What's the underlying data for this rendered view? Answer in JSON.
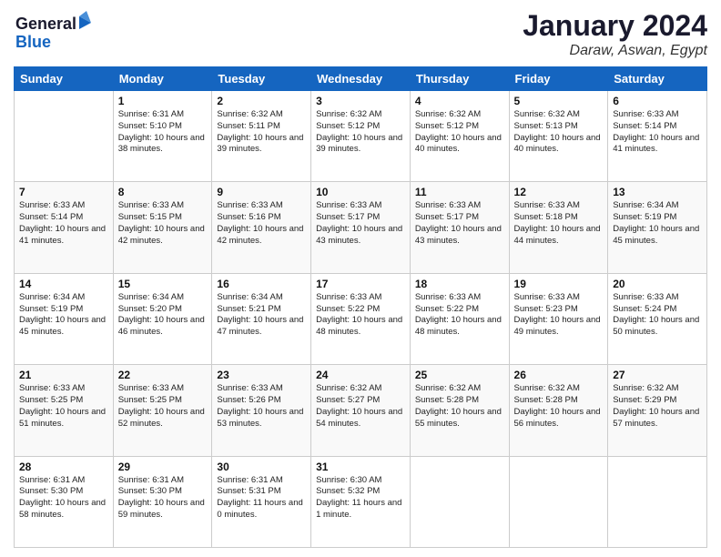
{
  "logo": {
    "line1": "General",
    "line2": "Blue"
  },
  "title": "January 2024",
  "location": "Daraw, Aswan, Egypt",
  "headers": [
    "Sunday",
    "Monday",
    "Tuesday",
    "Wednesday",
    "Thursday",
    "Friday",
    "Saturday"
  ],
  "weeks": [
    [
      {
        "day": "",
        "sunrise": "",
        "sunset": "",
        "daylight": ""
      },
      {
        "day": "1",
        "sunrise": "Sunrise: 6:31 AM",
        "sunset": "Sunset: 5:10 PM",
        "daylight": "Daylight: 10 hours and 38 minutes."
      },
      {
        "day": "2",
        "sunrise": "Sunrise: 6:32 AM",
        "sunset": "Sunset: 5:11 PM",
        "daylight": "Daylight: 10 hours and 39 minutes."
      },
      {
        "day": "3",
        "sunrise": "Sunrise: 6:32 AM",
        "sunset": "Sunset: 5:12 PM",
        "daylight": "Daylight: 10 hours and 39 minutes."
      },
      {
        "day": "4",
        "sunrise": "Sunrise: 6:32 AM",
        "sunset": "Sunset: 5:12 PM",
        "daylight": "Daylight: 10 hours and 40 minutes."
      },
      {
        "day": "5",
        "sunrise": "Sunrise: 6:32 AM",
        "sunset": "Sunset: 5:13 PM",
        "daylight": "Daylight: 10 hours and 40 minutes."
      },
      {
        "day": "6",
        "sunrise": "Sunrise: 6:33 AM",
        "sunset": "Sunset: 5:14 PM",
        "daylight": "Daylight: 10 hours and 41 minutes."
      }
    ],
    [
      {
        "day": "7",
        "sunrise": "Sunrise: 6:33 AM",
        "sunset": "Sunset: 5:14 PM",
        "daylight": "Daylight: 10 hours and 41 minutes."
      },
      {
        "day": "8",
        "sunrise": "Sunrise: 6:33 AM",
        "sunset": "Sunset: 5:15 PM",
        "daylight": "Daylight: 10 hours and 42 minutes."
      },
      {
        "day": "9",
        "sunrise": "Sunrise: 6:33 AM",
        "sunset": "Sunset: 5:16 PM",
        "daylight": "Daylight: 10 hours and 42 minutes."
      },
      {
        "day": "10",
        "sunrise": "Sunrise: 6:33 AM",
        "sunset": "Sunset: 5:17 PM",
        "daylight": "Daylight: 10 hours and 43 minutes."
      },
      {
        "day": "11",
        "sunrise": "Sunrise: 6:33 AM",
        "sunset": "Sunset: 5:17 PM",
        "daylight": "Daylight: 10 hours and 43 minutes."
      },
      {
        "day": "12",
        "sunrise": "Sunrise: 6:33 AM",
        "sunset": "Sunset: 5:18 PM",
        "daylight": "Daylight: 10 hours and 44 minutes."
      },
      {
        "day": "13",
        "sunrise": "Sunrise: 6:34 AM",
        "sunset": "Sunset: 5:19 PM",
        "daylight": "Daylight: 10 hours and 45 minutes."
      }
    ],
    [
      {
        "day": "14",
        "sunrise": "Sunrise: 6:34 AM",
        "sunset": "Sunset: 5:19 PM",
        "daylight": "Daylight: 10 hours and 45 minutes."
      },
      {
        "day": "15",
        "sunrise": "Sunrise: 6:34 AM",
        "sunset": "Sunset: 5:20 PM",
        "daylight": "Daylight: 10 hours and 46 minutes."
      },
      {
        "day": "16",
        "sunrise": "Sunrise: 6:34 AM",
        "sunset": "Sunset: 5:21 PM",
        "daylight": "Daylight: 10 hours and 47 minutes."
      },
      {
        "day": "17",
        "sunrise": "Sunrise: 6:33 AM",
        "sunset": "Sunset: 5:22 PM",
        "daylight": "Daylight: 10 hours and 48 minutes."
      },
      {
        "day": "18",
        "sunrise": "Sunrise: 6:33 AM",
        "sunset": "Sunset: 5:22 PM",
        "daylight": "Daylight: 10 hours and 48 minutes."
      },
      {
        "day": "19",
        "sunrise": "Sunrise: 6:33 AM",
        "sunset": "Sunset: 5:23 PM",
        "daylight": "Daylight: 10 hours and 49 minutes."
      },
      {
        "day": "20",
        "sunrise": "Sunrise: 6:33 AM",
        "sunset": "Sunset: 5:24 PM",
        "daylight": "Daylight: 10 hours and 50 minutes."
      }
    ],
    [
      {
        "day": "21",
        "sunrise": "Sunrise: 6:33 AM",
        "sunset": "Sunset: 5:25 PM",
        "daylight": "Daylight: 10 hours and 51 minutes."
      },
      {
        "day": "22",
        "sunrise": "Sunrise: 6:33 AM",
        "sunset": "Sunset: 5:25 PM",
        "daylight": "Daylight: 10 hours and 52 minutes."
      },
      {
        "day": "23",
        "sunrise": "Sunrise: 6:33 AM",
        "sunset": "Sunset: 5:26 PM",
        "daylight": "Daylight: 10 hours and 53 minutes."
      },
      {
        "day": "24",
        "sunrise": "Sunrise: 6:32 AM",
        "sunset": "Sunset: 5:27 PM",
        "daylight": "Daylight: 10 hours and 54 minutes."
      },
      {
        "day": "25",
        "sunrise": "Sunrise: 6:32 AM",
        "sunset": "Sunset: 5:28 PM",
        "daylight": "Daylight: 10 hours and 55 minutes."
      },
      {
        "day": "26",
        "sunrise": "Sunrise: 6:32 AM",
        "sunset": "Sunset: 5:28 PM",
        "daylight": "Daylight: 10 hours and 56 minutes."
      },
      {
        "day": "27",
        "sunrise": "Sunrise: 6:32 AM",
        "sunset": "Sunset: 5:29 PM",
        "daylight": "Daylight: 10 hours and 57 minutes."
      }
    ],
    [
      {
        "day": "28",
        "sunrise": "Sunrise: 6:31 AM",
        "sunset": "Sunset: 5:30 PM",
        "daylight": "Daylight: 10 hours and 58 minutes."
      },
      {
        "day": "29",
        "sunrise": "Sunrise: 6:31 AM",
        "sunset": "Sunset: 5:30 PM",
        "daylight": "Daylight: 10 hours and 59 minutes."
      },
      {
        "day": "30",
        "sunrise": "Sunrise: 6:31 AM",
        "sunset": "Sunset: 5:31 PM",
        "daylight": "Daylight: 11 hours and 0 minutes."
      },
      {
        "day": "31",
        "sunrise": "Sunrise: 6:30 AM",
        "sunset": "Sunset: 5:32 PM",
        "daylight": "Daylight: 11 hours and 1 minute."
      },
      {
        "day": "",
        "sunrise": "",
        "sunset": "",
        "daylight": ""
      },
      {
        "day": "",
        "sunrise": "",
        "sunset": "",
        "daylight": ""
      },
      {
        "day": "",
        "sunrise": "",
        "sunset": "",
        "daylight": ""
      }
    ]
  ]
}
